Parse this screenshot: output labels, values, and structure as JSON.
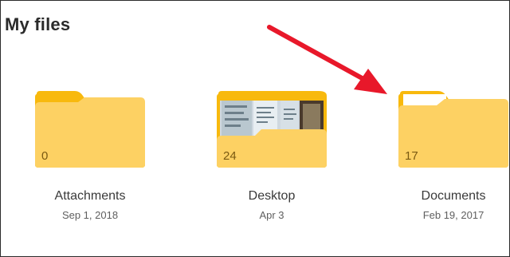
{
  "page": {
    "title": "My files"
  },
  "folders": [
    {
      "name": "Attachments",
      "date": "Sep 1, 2018",
      "count": "0",
      "icon": "folder-icon"
    },
    {
      "name": "Desktop",
      "date": "Apr 3",
      "count": "24",
      "icon": "folder-with-preview-icon"
    },
    {
      "name": "Documents",
      "date": "Feb 19, 2017",
      "count": "17",
      "icon": "folder-with-document-icon"
    }
  ],
  "colors": {
    "folder_back": "#f8b90d",
    "folder_front": "#fdd163",
    "annotation_arrow": "#e8182a"
  }
}
